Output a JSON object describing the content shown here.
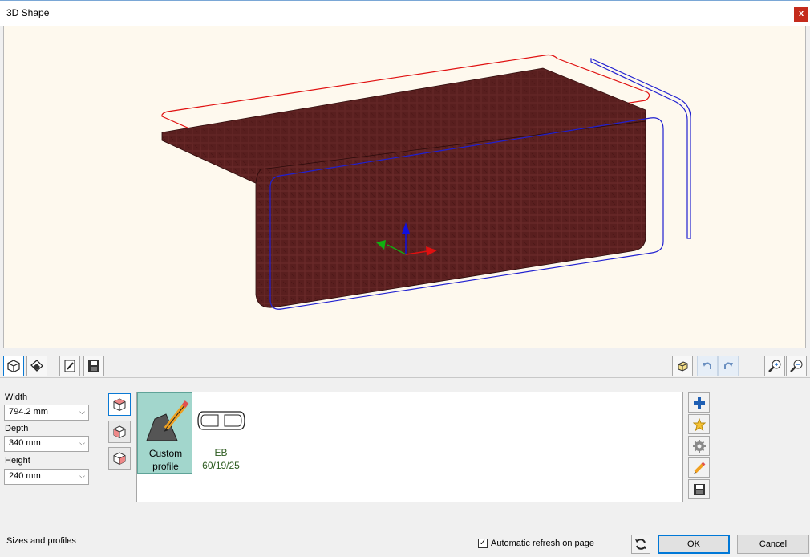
{
  "window": {
    "title": "3D Shape",
    "close_label": "x"
  },
  "viewport": {
    "background": "#fef9ee",
    "solid_color": "#5a1f1f",
    "axes": [
      "x",
      "y",
      "z"
    ]
  },
  "toolbar": {
    "left_icons": [
      "view-3d-icon",
      "paint-icon",
      "edit-document-icon",
      "save-icon"
    ],
    "right_icons": [
      "cube-view-icon",
      "undo-icon",
      "redo-icon",
      "zoom-in-icon",
      "zoom-out-icon"
    ]
  },
  "sizes": {
    "width": {
      "label": "Width",
      "value": "794.2 mm"
    },
    "depth": {
      "label": "Depth",
      "value": "340 mm"
    },
    "height": {
      "label": "Height",
      "value": "240 mm"
    }
  },
  "profiles": [
    {
      "name_line1": "Custom",
      "name_line2": "profile",
      "selected": true
    },
    {
      "name_line1": "EB",
      "name_line2": "60/19/25",
      "selected": false
    }
  ],
  "profile_actions": [
    "add-icon",
    "favorite-icon",
    "settings-icon",
    "edit-icon",
    "save-icon"
  ],
  "status": {
    "text": "Sizes and profiles",
    "auto_refresh_label": "Automatic refresh on page",
    "auto_refresh_checked": true,
    "check_mark": "✓"
  },
  "buttons": {
    "ok": "OK",
    "cancel": "Cancel"
  }
}
